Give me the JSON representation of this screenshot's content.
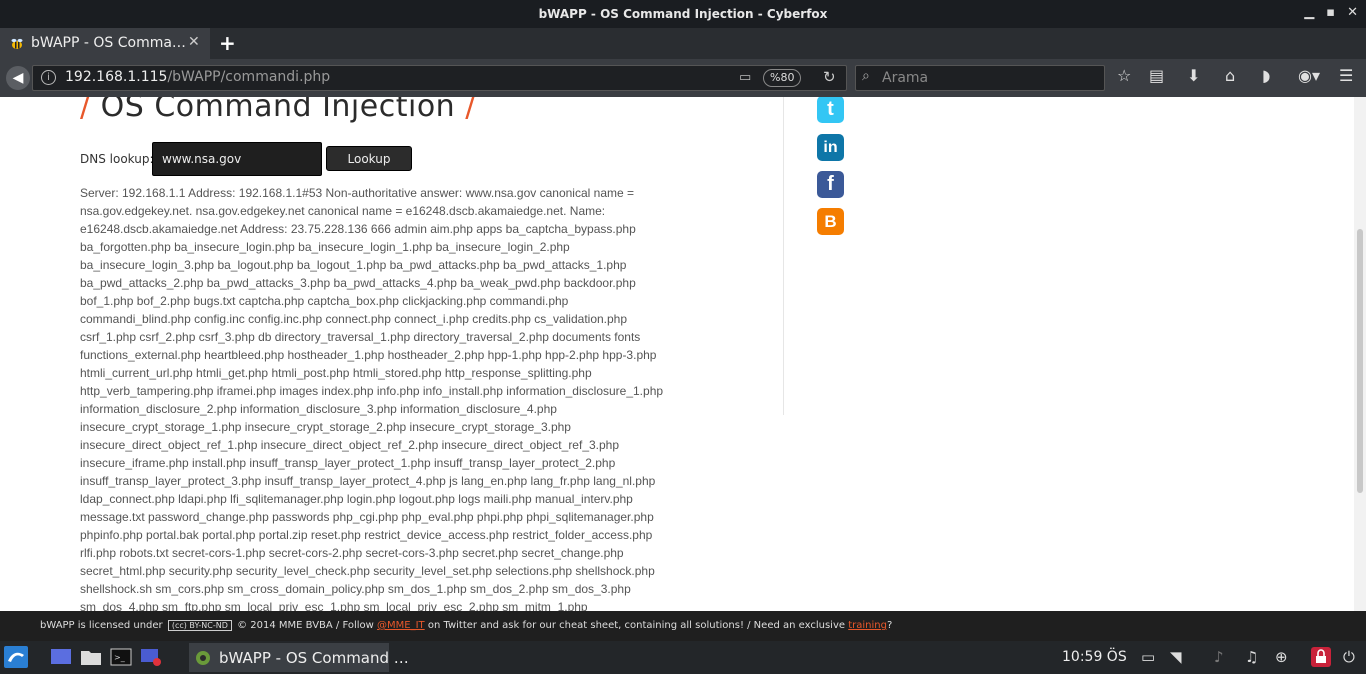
{
  "window": {
    "title": "bWAPP - OS Command Injection - Cyberfox",
    "controls": {
      "minimize": "▁",
      "maximize": "▪",
      "close": "✕"
    }
  },
  "tabs": [
    {
      "label": "bWAPP - OS Comma…",
      "close": "✕",
      "active": true
    }
  ],
  "new_tab": "+",
  "navigation": {
    "url_host": "192.168.1.115",
    "url_path": "/bWAPP/commandi.php",
    "zoom": "%80",
    "search_placeholder": "Arama"
  },
  "page": {
    "heading_slash": "/",
    "heading": "OS Command Injection",
    "dns_label": "DNS lookup:",
    "dns_value": "www.nsa.gov",
    "lookup_button": "Lookup",
    "output": "Server: 192.168.1.1 Address: 192.168.1.1#53 Non-authoritative answer: www.nsa.gov canonical name = nsa.gov.edgekey.net. nsa.gov.edgekey.net canonical name = e16248.dscb.akamaiedge.net. Name: e16248.dscb.akamaiedge.net Address: 23.75.228.136 666 admin aim.php apps ba_captcha_bypass.php ba_forgotten.php ba_insecure_login.php ba_insecure_login_1.php ba_insecure_login_2.php ba_insecure_login_3.php ba_logout.php ba_logout_1.php ba_pwd_attacks.php ba_pwd_attacks_1.php ba_pwd_attacks_2.php ba_pwd_attacks_3.php ba_pwd_attacks_4.php ba_weak_pwd.php backdoor.php bof_1.php bof_2.php bugs.txt captcha.php captcha_box.php clickjacking.php commandi.php commandi_blind.php config.inc config.inc.php connect.php connect_i.php credits.php cs_validation.php csrf_1.php csrf_2.php csrf_3.php db directory_traversal_1.php directory_traversal_2.php documents fonts functions_external.php heartbleed.php hostheader_1.php hostheader_2.php hpp-1.php hpp-2.php hpp-3.php htmli_current_url.php htmli_get.php htmli_post.php htmli_stored.php http_response_splitting.php http_verb_tampering.php iframei.php images index.php info.php info_install.php information_disclosure_1.php information_disclosure_2.php information_disclosure_3.php information_disclosure_4.php insecure_crypt_storage_1.php insecure_crypt_storage_2.php insecure_crypt_storage_3.php insecure_direct_object_ref_1.php insecure_direct_object_ref_2.php insecure_direct_object_ref_3.php insecure_iframe.php install.php insuff_transp_layer_protect_1.php insuff_transp_layer_protect_2.php insuff_transp_layer_protect_3.php insuff_transp_layer_protect_4.php js lang_en.php lang_fr.php lang_nl.php ldap_connect.php ldapi.php lfi_sqlitemanager.php login.php logout.php logs maili.php manual_interv.php message.txt password_change.php passwords php_cgi.php php_eval.php phpi.php phpi_sqlitemanager.php phpinfo.php portal.bak portal.php portal.zip reset.php restrict_device_access.php restrict_folder_access.php rlfi.php robots.txt secret-cors-1.php secret-cors-2.php secret-cors-3.php secret.php secret_change.php secret_html.php security.php security_level_check.php security_level_set.php selections.php shellshock.php shellshock.sh sm_cors.php sm_cross_domain_policy.php sm_dos_1.php sm_dos_2.php sm_dos_3.php sm_dos_4.php sm_ftp.php sm_local_priv_esc_1.php sm_local_priv_esc_2.php sm_mitm_1.php",
    "social": [
      {
        "name": "twitter",
        "glyph": "t",
        "color": "#33c6f4"
      },
      {
        "name": "linkedin",
        "glyph": "in",
        "color": "#0e76a8"
      },
      {
        "name": "facebook",
        "glyph": "f",
        "color": "#3b5998"
      },
      {
        "name": "blogger",
        "glyph": "B",
        "color": "#f57d00"
      }
    ]
  },
  "footer": {
    "part1": "bWAPP is licensed under",
    "license_badge": "(cc) BY-NC-ND",
    "part2": "© 2014 MME BVBA / Follow",
    "twitter_handle": "@MME_IT",
    "part3": "on Twitter and ask for our cheat sheet, containing all solutions! / Need an exclusive",
    "training_link": "training",
    "part4": "?"
  },
  "taskbar": {
    "window_label": "bWAPP - OS Command …",
    "clock": "10:59 ÖS"
  },
  "colors": {
    "accent": "#e8582b",
    "dark_bar": "#1f1f1f",
    "browser_chrome": "#3a3d42"
  }
}
